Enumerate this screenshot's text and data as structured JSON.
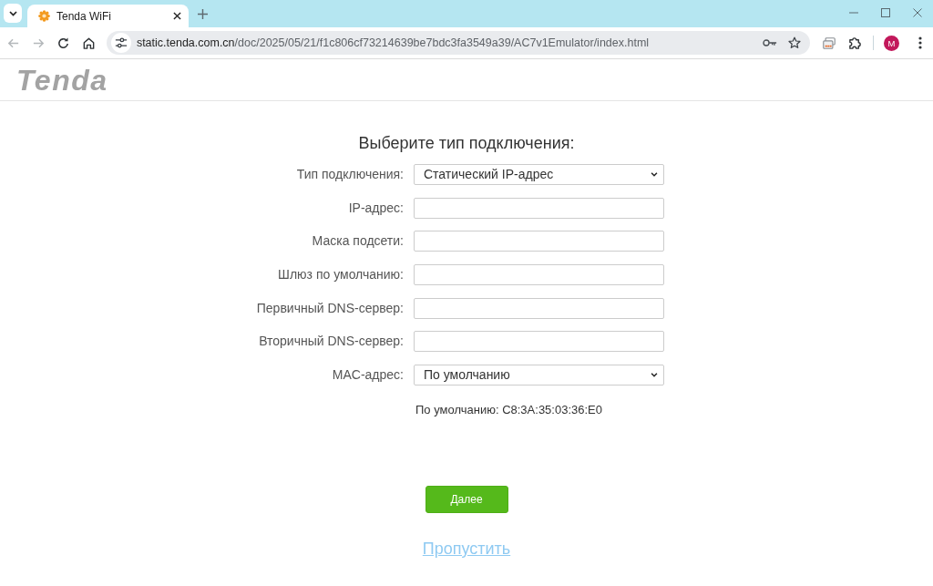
{
  "browser": {
    "tabs": [
      {
        "title": "Tenda WiFi",
        "selected": true
      }
    ],
    "back_disabled": true,
    "forward_disabled": true,
    "address": {
      "host": "static.tenda.com.cn",
      "path": "/doc/2025/05/21/f1c806cf73214639be7bdc3fa3549a39/AC7v1Emulator/index.html"
    },
    "profile_initial": "M"
  },
  "header": {
    "logo": "Tenda"
  },
  "form": {
    "title": "Выберите тип подключения:",
    "fields": [
      {
        "label": "Тип подключения:",
        "kind": "select",
        "value": "Статический IP-адрес"
      },
      {
        "label": "IP-адрес:",
        "kind": "text"
      },
      {
        "label": "Маска подсети:",
        "kind": "text"
      },
      {
        "label": "Шлюз по умолчанию:",
        "kind": "text"
      },
      {
        "label": "Первичный DNS-сервер:",
        "kind": "text"
      },
      {
        "label": "Вторичный DNS-сервер:",
        "kind": "text"
      },
      {
        "label": "MAC-адрес:",
        "kind": "select",
        "value": "По умолчанию"
      }
    ],
    "mac_note": "По умолчанию: C8:3A:35:03:36:E0"
  },
  "actions": {
    "next_button": "Далее",
    "skip_link": "Пропустить"
  }
}
